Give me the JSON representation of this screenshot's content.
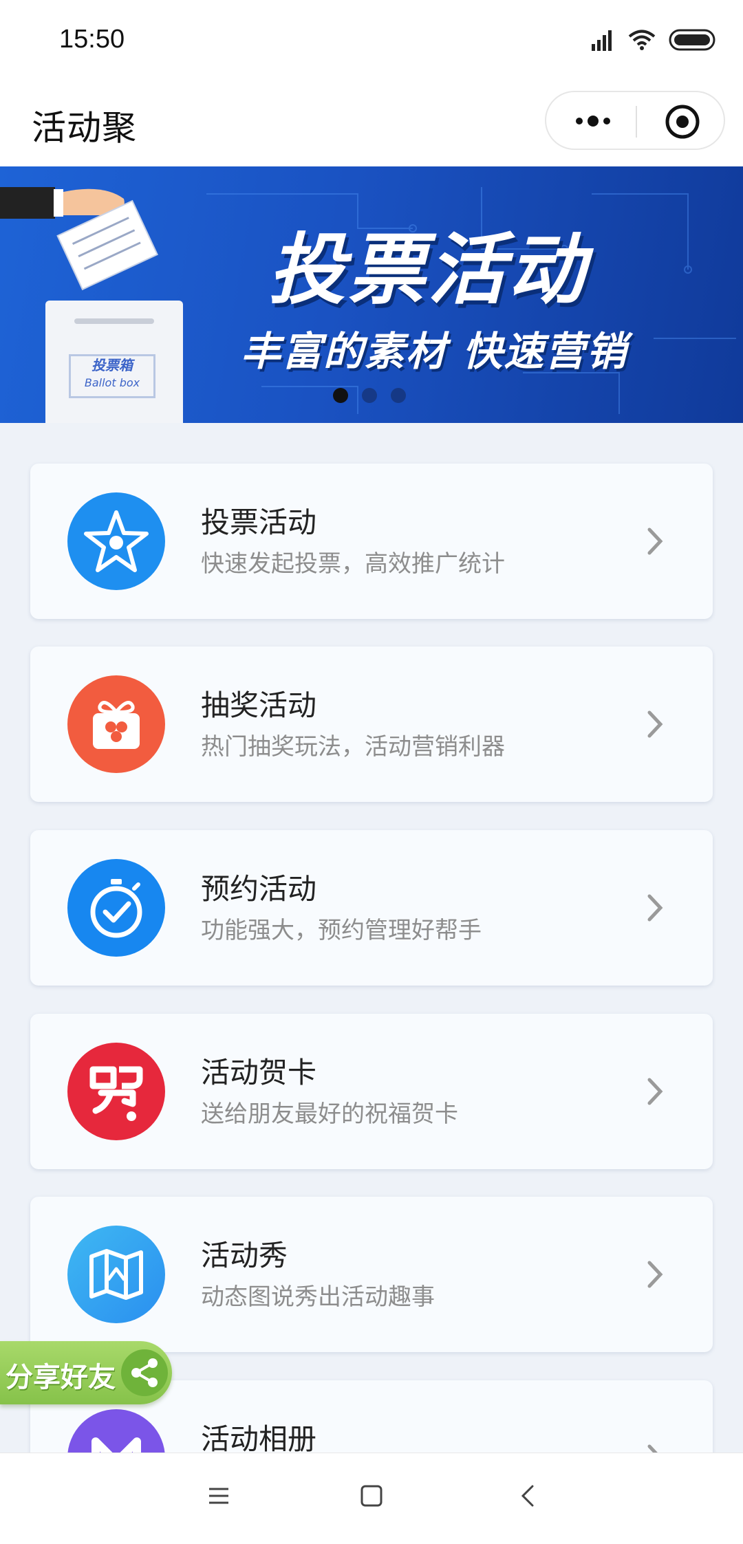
{
  "status_bar": {
    "time": "15:50"
  },
  "nav": {
    "title": "活动聚"
  },
  "banner": {
    "title": "投票活动",
    "subtitle": "丰富的素材 快速营销",
    "box_label_cn": "投票箱",
    "box_label_en": "Ballot box"
  },
  "cards": [
    {
      "title": "投票活动",
      "desc": "快速发起投票，高效推广统计",
      "color": "#1e8ff0"
    },
    {
      "title": "抽奖活动",
      "desc": "热门抽奖玩法，活动营销利器",
      "color": "#f25c3f"
    },
    {
      "title": "预约活动",
      "desc": "功能强大，预约管理好帮手",
      "color": "#1787f0"
    },
    {
      "title": "活动贺卡",
      "desc": "送给朋友最好的祝福贺卡",
      "color": "#e6283c"
    },
    {
      "title": "活动秀",
      "desc": "动态图说秀出活动趣事",
      "color": "#34a6f0"
    },
    {
      "title": "活动相册",
      "desc": "",
      "color": "#7b55e8"
    }
  ],
  "share": {
    "label": "分享好友"
  }
}
